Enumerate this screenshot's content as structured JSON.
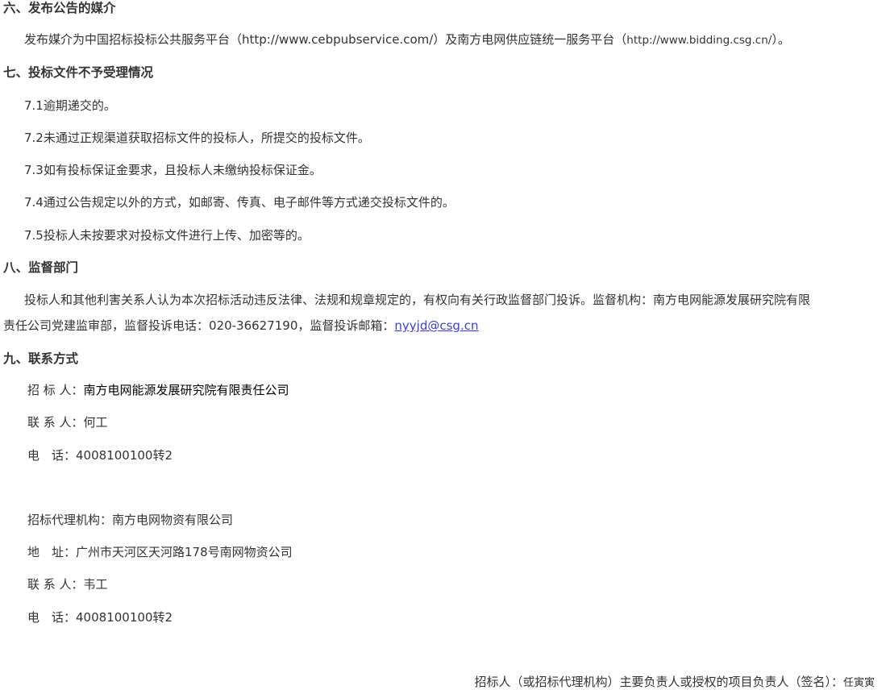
{
  "sections": {
    "s6": {
      "heading": "六、发布公告的媒介",
      "text_a": "发布媒介为中国招标投标公共服务平台（http://www.cebpubservice.com/）及南方电网供应链统一服务平台（",
      "url": "http://www.bidding.csg.cn/",
      "text_b": "）。"
    },
    "s7": {
      "heading": "七、投标文件不予受理情况",
      "items": [
        "7.1逾期递交的。",
        "7.2未通过正规渠道获取招标文件的投标人，所提交的投标文件。",
        "7.3如有投标保证金要求，且投标人未缴纳投标保证金。",
        "7.4通过公告规定以外的方式，如邮寄、传真、电子邮件等方式递交投标文件的。",
        "7.5投标人未按要求对投标文件进行上传、加密等的。"
      ]
    },
    "s8": {
      "heading": "八、监督部门",
      "line1": "投标人和其他利害关系人认为本次招标活动违反法律、法规和规章规定的，有权向有关行政监督部门投诉。监督机构：南方电网能源发展研究院有限",
      "line2": "责任公司党建监审部，监督投诉电话：020-36627190，监督投诉邮箱：",
      "email": "nyyjd@csg.cn"
    },
    "s9": {
      "heading": "九、联系方式",
      "tenderer_label": "招 标 人：",
      "tenderer": "南方电网能源发展研究院有限责任公司",
      "contact_label": "联 系 人：",
      "contact": "何工",
      "phone_label": "电　话：",
      "phone": "4008100100转2",
      "agency_label": "招标代理机构：",
      "agency": "南方电网物资有限公司",
      "address_label": "地　址：",
      "address": "广州市天河区天河路178号南网物资公司",
      "agency_contact_label": "联 系 人：",
      "agency_contact": "韦工",
      "agency_phone_label": "电　话：",
      "agency_phone": "4008100100转2"
    }
  },
  "signature": {
    "label": "招标人（或招标代理机构）主要负责人或授权的项目负责人（签名）：",
    "name": "任寅寅"
  }
}
